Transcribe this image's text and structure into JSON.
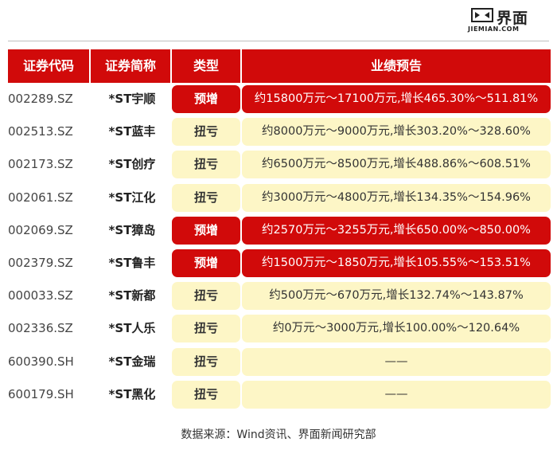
{
  "brand": {
    "name_cn": "界面",
    "name_en": "JIEMIAN.COM",
    "icon": "jiemian-logo-icon"
  },
  "colors": {
    "accent": "#d10a0a",
    "highlight": "#fdf6c6"
  },
  "table": {
    "headers": [
      "证券代码",
      "证券简称",
      "类型",
      "业绩预告"
    ],
    "rows": [
      {
        "code": "002289.SZ",
        "name": "*ST宇顺",
        "type": "预增",
        "forecast": "约15800万元～17100万元,增长465.30%～511.81%"
      },
      {
        "code": "002513.SZ",
        "name": "*ST蓝丰",
        "type": "扭亏",
        "forecast": "约8000万元～9000万元,增长303.20%～328.60%"
      },
      {
        "code": "002173.SZ",
        "name": "*ST创疗",
        "type": "扭亏",
        "forecast": "约6500万元～8500万元,增长488.86%～608.51%"
      },
      {
        "code": "002061.SZ",
        "name": "*ST江化",
        "type": "扭亏",
        "forecast": "约3000万元～4800万元,增长134.35%～154.96%"
      },
      {
        "code": "002069.SZ",
        "name": "*ST獐岛",
        "type": "预增",
        "forecast": "约2570万元～3255万元,增长650.00%～850.00%"
      },
      {
        "code": "002379.SZ",
        "name": "*ST鲁丰",
        "type": "预增",
        "forecast": "约1500万元～1850万元,增长105.55%～153.51%"
      },
      {
        "code": "000033.SZ",
        "name": "*ST新都",
        "type": "扭亏",
        "forecast": "约500万元～670万元,增长132.74%～143.87%"
      },
      {
        "code": "002336.SZ",
        "name": "*ST人乐",
        "type": "扭亏",
        "forecast": "约0万元～3000万元,增长100.00%～120.64%"
      },
      {
        "code": "600390.SH",
        "name": "*ST金瑞",
        "type": "扭亏",
        "forecast": "——"
      },
      {
        "code": "600179.SH",
        "name": "*ST黑化",
        "type": "扭亏",
        "forecast": "——"
      }
    ]
  },
  "source": "数据来源：Wind资讯、界面新闻研究部"
}
